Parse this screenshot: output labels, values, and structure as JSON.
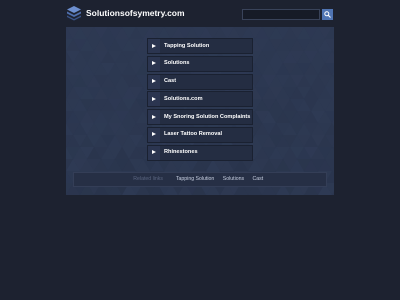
{
  "header": {
    "site_title": "Solutionsofsymetry.com",
    "logo_icon": "stacked-layers-logo",
    "search": {
      "placeholder": "",
      "value": "",
      "button_icon": "search-icon"
    }
  },
  "links": [
    {
      "label": "Tapping Solution"
    },
    {
      "label": "Solutions"
    },
    {
      "label": "Cast"
    },
    {
      "label": "Solutions.com"
    },
    {
      "label": "My Snoring Solution Complaints"
    },
    {
      "label": "Laser Tattoo Removal"
    },
    {
      "label": "Rhinestones"
    }
  ],
  "related": {
    "label": "Related links",
    "links": [
      "Tapping Solution",
      "Solutions",
      "Cast"
    ]
  },
  "colors": {
    "page_background": "#1d2230",
    "panel_background": "#2f3b55",
    "link_background": "#242d42",
    "accent": "#4f74b3"
  }
}
